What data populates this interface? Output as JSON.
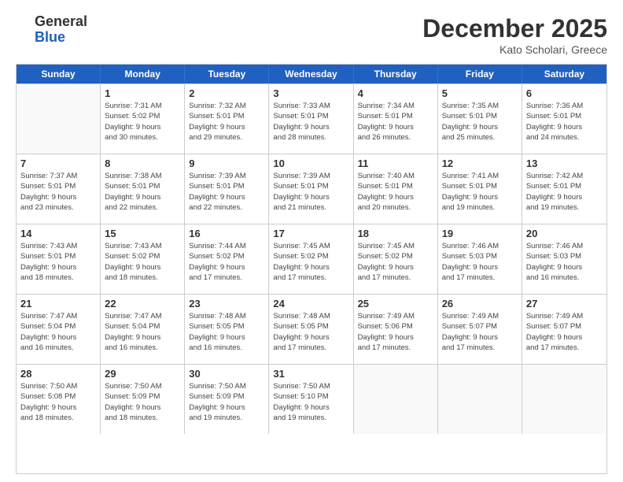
{
  "header": {
    "logo_general": "General",
    "logo_blue": "Blue",
    "month_title": "December 2025",
    "location": "Kato Scholari, Greece"
  },
  "weekdays": [
    "Sunday",
    "Monday",
    "Tuesday",
    "Wednesday",
    "Thursday",
    "Friday",
    "Saturday"
  ],
  "weeks": [
    [
      {
        "day": "",
        "sunrise": "",
        "sunset": "",
        "daylight": ""
      },
      {
        "day": "1",
        "sunrise": "Sunrise: 7:31 AM",
        "sunset": "Sunset: 5:02 PM",
        "daylight": "Daylight: 9 hours and 30 minutes."
      },
      {
        "day": "2",
        "sunrise": "Sunrise: 7:32 AM",
        "sunset": "Sunset: 5:01 PM",
        "daylight": "Daylight: 9 hours and 29 minutes."
      },
      {
        "day": "3",
        "sunrise": "Sunrise: 7:33 AM",
        "sunset": "Sunset: 5:01 PM",
        "daylight": "Daylight: 9 hours and 28 minutes."
      },
      {
        "day": "4",
        "sunrise": "Sunrise: 7:34 AM",
        "sunset": "Sunset: 5:01 PM",
        "daylight": "Daylight: 9 hours and 26 minutes."
      },
      {
        "day": "5",
        "sunrise": "Sunrise: 7:35 AM",
        "sunset": "Sunset: 5:01 PM",
        "daylight": "Daylight: 9 hours and 25 minutes."
      },
      {
        "day": "6",
        "sunrise": "Sunrise: 7:36 AM",
        "sunset": "Sunset: 5:01 PM",
        "daylight": "Daylight: 9 hours and 24 minutes."
      }
    ],
    [
      {
        "day": "7",
        "sunrise": "Sunrise: 7:37 AM",
        "sunset": "Sunset: 5:01 PM",
        "daylight": "Daylight: 9 hours and 23 minutes."
      },
      {
        "day": "8",
        "sunrise": "Sunrise: 7:38 AM",
        "sunset": "Sunset: 5:01 PM",
        "daylight": "Daylight: 9 hours and 22 minutes."
      },
      {
        "day": "9",
        "sunrise": "Sunrise: 7:39 AM",
        "sunset": "Sunset: 5:01 PM",
        "daylight": "Daylight: 9 hours and 22 minutes."
      },
      {
        "day": "10",
        "sunrise": "Sunrise: 7:39 AM",
        "sunset": "Sunset: 5:01 PM",
        "daylight": "Daylight: 9 hours and 21 minutes."
      },
      {
        "day": "11",
        "sunrise": "Sunrise: 7:40 AM",
        "sunset": "Sunset: 5:01 PM",
        "daylight": "Daylight: 9 hours and 20 minutes."
      },
      {
        "day": "12",
        "sunrise": "Sunrise: 7:41 AM",
        "sunset": "Sunset: 5:01 PM",
        "daylight": "Daylight: 9 hours and 19 minutes."
      },
      {
        "day": "13",
        "sunrise": "Sunrise: 7:42 AM",
        "sunset": "Sunset: 5:01 PM",
        "daylight": "Daylight: 9 hours and 19 minutes."
      }
    ],
    [
      {
        "day": "14",
        "sunrise": "Sunrise: 7:43 AM",
        "sunset": "Sunset: 5:01 PM",
        "daylight": "Daylight: 9 hours and 18 minutes."
      },
      {
        "day": "15",
        "sunrise": "Sunrise: 7:43 AM",
        "sunset": "Sunset: 5:02 PM",
        "daylight": "Daylight: 9 hours and 18 minutes."
      },
      {
        "day": "16",
        "sunrise": "Sunrise: 7:44 AM",
        "sunset": "Sunset: 5:02 PM",
        "daylight": "Daylight: 9 hours and 17 minutes."
      },
      {
        "day": "17",
        "sunrise": "Sunrise: 7:45 AM",
        "sunset": "Sunset: 5:02 PM",
        "daylight": "Daylight: 9 hours and 17 minutes."
      },
      {
        "day": "18",
        "sunrise": "Sunrise: 7:45 AM",
        "sunset": "Sunset: 5:02 PM",
        "daylight": "Daylight: 9 hours and 17 minutes."
      },
      {
        "day": "19",
        "sunrise": "Sunrise: 7:46 AM",
        "sunset": "Sunset: 5:03 PM",
        "daylight": "Daylight: 9 hours and 17 minutes."
      },
      {
        "day": "20",
        "sunrise": "Sunrise: 7:46 AM",
        "sunset": "Sunset: 5:03 PM",
        "daylight": "Daylight: 9 hours and 16 minutes."
      }
    ],
    [
      {
        "day": "21",
        "sunrise": "Sunrise: 7:47 AM",
        "sunset": "Sunset: 5:04 PM",
        "daylight": "Daylight: 9 hours and 16 minutes."
      },
      {
        "day": "22",
        "sunrise": "Sunrise: 7:47 AM",
        "sunset": "Sunset: 5:04 PM",
        "daylight": "Daylight: 9 hours and 16 minutes."
      },
      {
        "day": "23",
        "sunrise": "Sunrise: 7:48 AM",
        "sunset": "Sunset: 5:05 PM",
        "daylight": "Daylight: 9 hours and 16 minutes."
      },
      {
        "day": "24",
        "sunrise": "Sunrise: 7:48 AM",
        "sunset": "Sunset: 5:05 PM",
        "daylight": "Daylight: 9 hours and 17 minutes."
      },
      {
        "day": "25",
        "sunrise": "Sunrise: 7:49 AM",
        "sunset": "Sunset: 5:06 PM",
        "daylight": "Daylight: 9 hours and 17 minutes."
      },
      {
        "day": "26",
        "sunrise": "Sunrise: 7:49 AM",
        "sunset": "Sunset: 5:07 PM",
        "daylight": "Daylight: 9 hours and 17 minutes."
      },
      {
        "day": "27",
        "sunrise": "Sunrise: 7:49 AM",
        "sunset": "Sunset: 5:07 PM",
        "daylight": "Daylight: 9 hours and 17 minutes."
      }
    ],
    [
      {
        "day": "28",
        "sunrise": "Sunrise: 7:50 AM",
        "sunset": "Sunset: 5:08 PM",
        "daylight": "Daylight: 9 hours and 18 minutes."
      },
      {
        "day": "29",
        "sunrise": "Sunrise: 7:50 AM",
        "sunset": "Sunset: 5:09 PM",
        "daylight": "Daylight: 9 hours and 18 minutes."
      },
      {
        "day": "30",
        "sunrise": "Sunrise: 7:50 AM",
        "sunset": "Sunset: 5:09 PM",
        "daylight": "Daylight: 9 hours and 19 minutes."
      },
      {
        "day": "31",
        "sunrise": "Sunrise: 7:50 AM",
        "sunset": "Sunset: 5:10 PM",
        "daylight": "Daylight: 9 hours and 19 minutes."
      },
      {
        "day": "",
        "sunrise": "",
        "sunset": "",
        "daylight": ""
      },
      {
        "day": "",
        "sunrise": "",
        "sunset": "",
        "daylight": ""
      },
      {
        "day": "",
        "sunrise": "",
        "sunset": "",
        "daylight": ""
      }
    ]
  ]
}
